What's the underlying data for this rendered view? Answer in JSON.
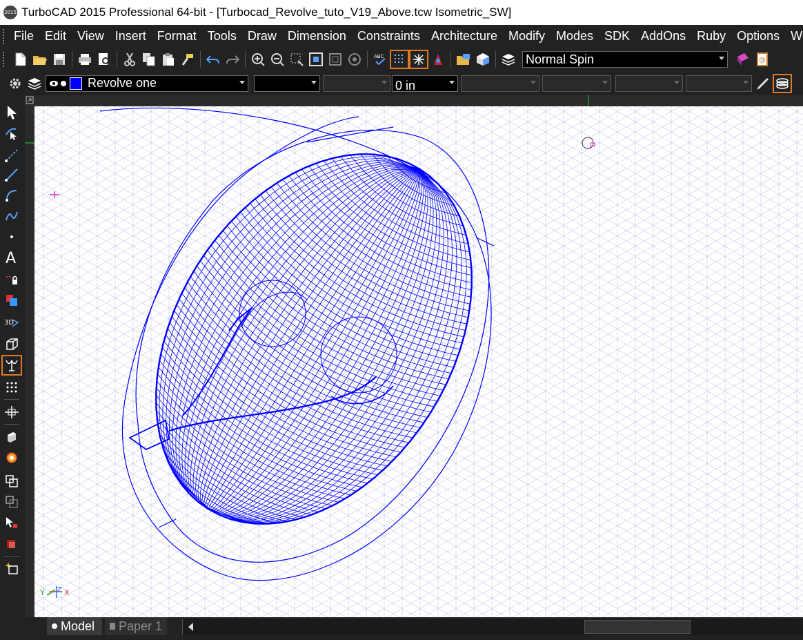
{
  "window": {
    "logo_text": "2015",
    "title": "TurboCAD 2015 Professional 64-bit - [Turbocad_Revolve_tuto_V19_Above.tcw Isometric_SW]"
  },
  "menu": [
    "File",
    "Edit",
    "View",
    "Insert",
    "Format",
    "Tools",
    "Draw",
    "Dimension",
    "Constraints",
    "Architecture",
    "Modify",
    "Modes",
    "SDK",
    "AddOns",
    "Ruby",
    "Options",
    "Win"
  ],
  "toolbar_main": {
    "icons": [
      "new-file-icon",
      "open-folder-icon",
      "save-icon",
      "print-icon",
      "print-preview-icon",
      "cut-icon",
      "copy-icon",
      "paste-icon",
      "format-painter-icon",
      "undo-icon",
      "redo-icon",
      "zoom-in-icon",
      "zoom-out-icon",
      "zoom-window-icon",
      "zoom-extents-icon",
      "zoom-previous-icon",
      "zoom-realtime-icon",
      "spell-check-icon",
      "grid-snap-icon",
      "snap-star-icon",
      "render-palette-icon",
      "open-library-icon",
      "view-cube-icon",
      "layer-list-icon"
    ],
    "spin_mode": "Normal Spin",
    "tail_icons": [
      "book-icon",
      "email-icon"
    ]
  },
  "toolbar_props": {
    "object_name": "Revolve one",
    "color_hex": "#0000ff",
    "line_width_value": "0 in"
  },
  "toolbox": [
    "select-arrow-icon",
    "edit-tool-icon",
    "point-line-icon",
    "line-icon",
    "arc-icon",
    "spline-icon",
    "point-icon",
    "text-tool-icon",
    "lock-icon",
    "fill-icon",
    "3d-tool-icon",
    "box-3d-icon",
    "revolve-tool-icon",
    "pattern-icon",
    "move-tool-icon",
    "extrude-icon",
    "gear-tool-icon",
    "layers-icon",
    "copy-tool-icon",
    "magic-icon",
    "render-icon",
    "sparkle-icon"
  ],
  "canvas": {
    "axis_y": "Y",
    "axis_x": "X",
    "axis_z": "Z",
    "wire_color": "#0000ff"
  },
  "tabs": [
    {
      "label": "Model",
      "active": true
    },
    {
      "label": "Paper 1",
      "active": false
    }
  ]
}
